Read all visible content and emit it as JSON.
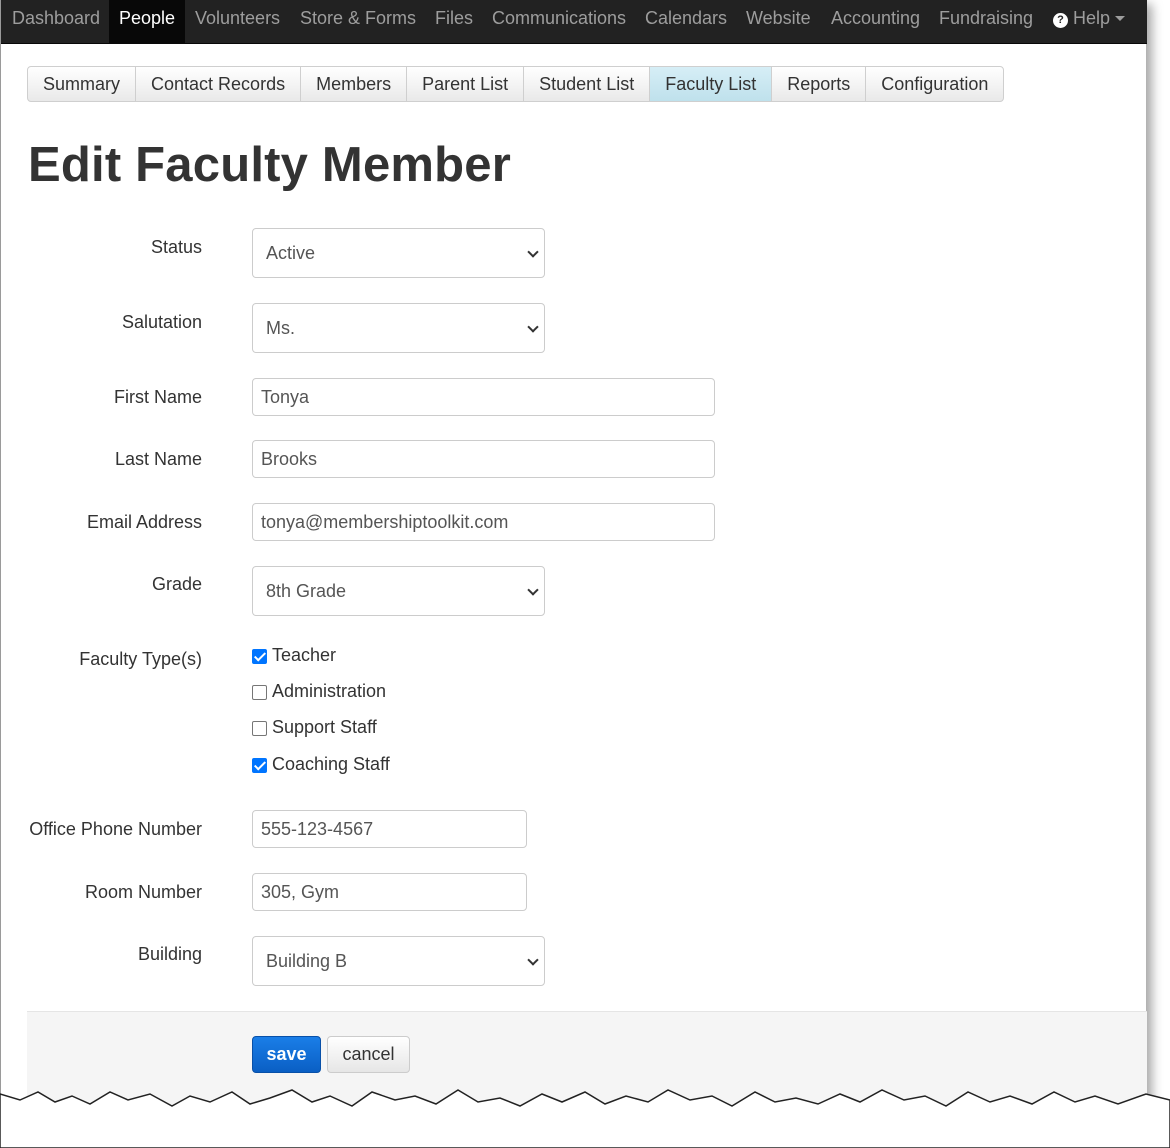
{
  "navbar": {
    "items": [
      {
        "label": "Dashboard"
      },
      {
        "label": "People",
        "active": true
      },
      {
        "label": "Volunteers"
      },
      {
        "label": "Store & Forms"
      },
      {
        "label": "Files"
      },
      {
        "label": "Communications"
      },
      {
        "label": "Calendars"
      },
      {
        "label": "Website"
      },
      {
        "label": "Accounting"
      },
      {
        "label": "Fundraising"
      },
      {
        "label": "Help",
        "icon": "question-circle-icon",
        "dropdown": true
      }
    ]
  },
  "tabs": [
    {
      "label": "Summary"
    },
    {
      "label": "Contact Records"
    },
    {
      "label": "Members"
    },
    {
      "label": "Parent List"
    },
    {
      "label": "Student List"
    },
    {
      "label": "Faculty List",
      "active": true
    },
    {
      "label": "Reports"
    },
    {
      "label": "Configuration"
    }
  ],
  "page_title": "Edit Faculty Member",
  "form": {
    "status": {
      "label": "Status",
      "value": "Active"
    },
    "salutation": {
      "label": "Salutation",
      "value": "Ms."
    },
    "first_name": {
      "label": "First Name",
      "value": "Tonya"
    },
    "last_name": {
      "label": "Last Name",
      "value": "Brooks"
    },
    "email": {
      "label": "Email Address",
      "value": "tonya@membershiptoolkit.com"
    },
    "grade": {
      "label": "Grade",
      "value": "8th Grade"
    },
    "faculty_types": {
      "label": "Faculty Type(s)",
      "options": [
        {
          "label": "Teacher",
          "checked": true
        },
        {
          "label": "Administration",
          "checked": false
        },
        {
          "label": "Support Staff",
          "checked": false
        },
        {
          "label": "Coaching Staff",
          "checked": true
        }
      ]
    },
    "office_phone": {
      "label": "Office Phone Number",
      "value": "555-123-4567"
    },
    "room_number": {
      "label": "Room Number",
      "value": "305, Gym"
    },
    "building": {
      "label": "Building",
      "value": "Building B"
    }
  },
  "actions": {
    "save_label": "save",
    "cancel_label": "cancel"
  },
  "colors": {
    "navbar_bg": "#222222",
    "active_tab": "#bfe1ec",
    "primary_button": "#0a5fc4",
    "checkbox": "#0075ff"
  }
}
